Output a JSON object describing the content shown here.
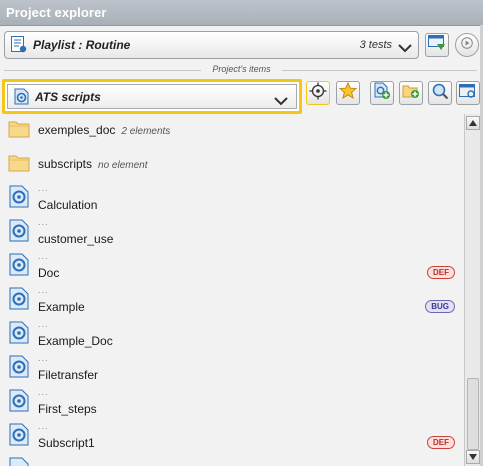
{
  "panel": {
    "title": "Project explorer"
  },
  "playlist": {
    "label": "Playlist : Routine",
    "count": "3 tests"
  },
  "section_label": "Project's items",
  "selector": {
    "label": "ATS scripts"
  },
  "items": [
    {
      "name": "exemples_doc",
      "sub": "2 elements",
      "type": "folder"
    },
    {
      "name": "subscripts",
      "sub": "no element",
      "type": "folder"
    },
    {
      "name": "Calculation",
      "dots": "...",
      "type": "script"
    },
    {
      "name": "customer_use",
      "dots": "...",
      "type": "script"
    },
    {
      "name": "Doc",
      "dots": "...",
      "type": "script",
      "badge": "DEF"
    },
    {
      "name": "Example",
      "dots": "...",
      "type": "script",
      "badge": "BUG"
    },
    {
      "name": "Example_Doc",
      "dots": "...",
      "type": "script"
    },
    {
      "name": "Filetransfer",
      "dots": "...",
      "type": "script"
    },
    {
      "name": "First_steps",
      "dots": "...",
      "type": "script"
    },
    {
      "name": "Subscript1",
      "dots": "...",
      "type": "script",
      "badge": "DEF"
    }
  ],
  "colors": {
    "highlight": "#f5c518",
    "def": "#c9423a",
    "bug": "#6b68b0",
    "icon_blue": "#2d6fb4"
  },
  "icons": [
    "playlist-icon",
    "chevron-down-icon",
    "export-icon",
    "play-icon",
    "script-icon",
    "target-icon",
    "star-icon",
    "new-script-icon",
    "new-folder-icon",
    "search-icon",
    "explorer-icon",
    "folder-icon"
  ]
}
